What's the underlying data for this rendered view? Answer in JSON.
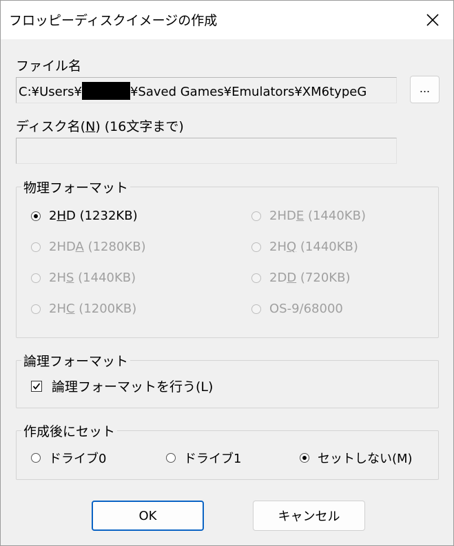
{
  "window": {
    "title": "フロッピーディスクイメージの作成",
    "close_icon": "close-icon"
  },
  "file": {
    "label": "ファイル名",
    "path_prefix": "C:¥Users¥",
    "path_suffix": "¥Saved Games¥Emulators¥XM6typeG",
    "browse_label": "..."
  },
  "disk_name": {
    "label_prefix": "ディスク名(",
    "label_mnemonic": "N",
    "label_suffix": ") (16文字まで)",
    "value": ""
  },
  "physical_format": {
    "legend": "物理フォーマット",
    "options": [
      {
        "pre": "2",
        "key": "H",
        "post": "D (1232KB)",
        "checked": true,
        "enabled": true
      },
      {
        "pre": "2HD",
        "key": "E",
        "post": " (1440KB)",
        "checked": false,
        "enabled": false
      },
      {
        "pre": "2HD",
        "key": "A",
        "post": " (1280KB)",
        "checked": false,
        "enabled": false
      },
      {
        "pre": "2H",
        "key": "Q",
        "post": " (1440KB)",
        "checked": false,
        "enabled": false
      },
      {
        "pre": "2H",
        "key": "S",
        "post": " (1440KB)",
        "checked": false,
        "enabled": false
      },
      {
        "pre": "2D",
        "key": "D",
        "post": " (720KB)",
        "checked": false,
        "enabled": false
      },
      {
        "pre": "2H",
        "key": "C",
        "post": " (1200KB)",
        "checked": false,
        "enabled": false
      },
      {
        "pre": "OS-9/68000",
        "key": "",
        "post": "",
        "checked": false,
        "enabled": false
      }
    ]
  },
  "logical_format": {
    "legend": "論理フォーマット",
    "checkbox_label": "論理フォーマットを行う(L)",
    "checked": true
  },
  "after_create": {
    "legend": "作成後にセット",
    "options": [
      {
        "label": "ドライブ0",
        "checked": false
      },
      {
        "label": "ドライブ1",
        "checked": false
      },
      {
        "label": "セットしない(M)",
        "checked": true
      }
    ]
  },
  "buttons": {
    "ok": "OK",
    "cancel": "キャンセル"
  },
  "colors": {
    "dialog_bg": "#f0f0f0",
    "titlebar_bg": "#ffffff",
    "default_button_border": "#0a63c4",
    "disabled_text": "#a0a0a0"
  }
}
